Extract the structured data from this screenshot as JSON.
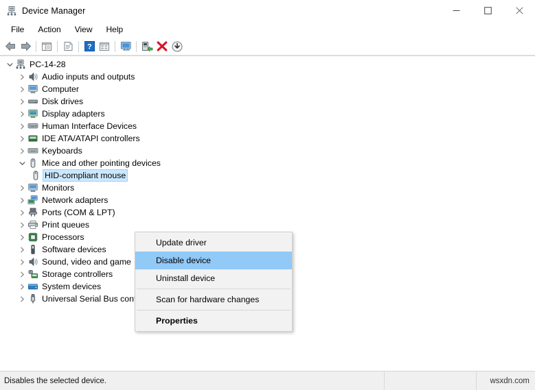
{
  "window": {
    "title": "Device Manager",
    "icon": "device-manager-icon",
    "controls": {
      "minimize": "─",
      "maximize": "□",
      "close": "✕"
    }
  },
  "menubar": {
    "items": [
      {
        "label": "File",
        "name": "menu-file"
      },
      {
        "label": "Action",
        "name": "menu-action"
      },
      {
        "label": "View",
        "name": "menu-view"
      },
      {
        "label": "Help",
        "name": "menu-help"
      }
    ]
  },
  "toolbar": {
    "buttons": [
      {
        "name": "back-icon",
        "tip": "Back"
      },
      {
        "name": "forward-icon",
        "tip": "Forward"
      },
      {
        "name": "show-hide-console-tree-icon",
        "tip": "Show/Hide Console Tree"
      },
      {
        "name": "properties-icon",
        "tip": "Properties"
      },
      {
        "name": "help-icon",
        "tip": "Help"
      },
      {
        "name": "view-list-icon",
        "tip": "View"
      },
      {
        "name": "update-driver-icon",
        "tip": "Update driver"
      },
      {
        "name": "enable-device-icon",
        "tip": "Enable device"
      },
      {
        "name": "uninstall-device-icon",
        "tip": "Uninstall device"
      },
      {
        "name": "scan-hardware-changes-icon",
        "tip": "Scan for hardware changes"
      }
    ]
  },
  "tree": {
    "root": {
      "label": "PC-14-28",
      "icon": "computer-root-icon",
      "expanded": true
    },
    "nodes": [
      {
        "label": "Audio inputs and outputs",
        "icon": "speaker-icon",
        "level": 1,
        "expanded": false,
        "selected": false
      },
      {
        "label": "Computer",
        "icon": "monitor-icon",
        "level": 1,
        "expanded": false,
        "selected": false
      },
      {
        "label": "Disk drives",
        "icon": "disk-icon",
        "level": 1,
        "expanded": false,
        "selected": false
      },
      {
        "label": "Display adapters",
        "icon": "display-adapter-icon",
        "level": 1,
        "expanded": false,
        "selected": false
      },
      {
        "label": "Human Interface Devices",
        "icon": "hid-icon",
        "level": 1,
        "expanded": false,
        "selected": false
      },
      {
        "label": "IDE ATA/ATAPI controllers",
        "icon": "ide-controller-icon",
        "level": 1,
        "expanded": false,
        "selected": false
      },
      {
        "label": "Keyboards",
        "icon": "keyboard-icon",
        "level": 1,
        "expanded": false,
        "selected": false
      },
      {
        "label": "Mice and other pointing devices",
        "icon": "mouse-icon",
        "level": 1,
        "expanded": true,
        "selected": false
      },
      {
        "label": "HID-compliant mouse",
        "icon": "mouse-icon",
        "level": 2,
        "expanded": null,
        "selected": true
      },
      {
        "label": "Monitors",
        "icon": "monitor-icon",
        "level": 1,
        "expanded": false,
        "selected": false
      },
      {
        "label": "Network adapters",
        "icon": "network-icon",
        "level": 1,
        "expanded": false,
        "selected": false
      },
      {
        "label": "Ports (COM & LPT)",
        "icon": "port-icon",
        "level": 1,
        "expanded": false,
        "selected": false
      },
      {
        "label": "Print queues",
        "icon": "printer-icon",
        "level": 1,
        "expanded": false,
        "selected": false
      },
      {
        "label": "Processors",
        "icon": "processor-icon",
        "level": 1,
        "expanded": false,
        "selected": false
      },
      {
        "label": "Software devices",
        "icon": "software-device-icon",
        "level": 1,
        "expanded": false,
        "selected": false
      },
      {
        "label": "Sound, video and game",
        "icon": "speaker-icon",
        "level": 1,
        "expanded": false,
        "selected": false
      },
      {
        "label": "Storage controllers",
        "icon": "storage-controller-icon",
        "level": 1,
        "expanded": false,
        "selected": false
      },
      {
        "label": "System devices",
        "icon": "system-device-icon",
        "level": 1,
        "expanded": false,
        "selected": false
      },
      {
        "label": "Universal Serial Bus controllers",
        "icon": "usb-icon",
        "level": 1,
        "expanded": false,
        "selected": false
      }
    ]
  },
  "context_menu": {
    "items": [
      {
        "label": "Update driver",
        "highlight": false,
        "bold": false,
        "separator_after": false
      },
      {
        "label": "Disable device",
        "highlight": true,
        "bold": false,
        "separator_after": false
      },
      {
        "label": "Uninstall device",
        "highlight": false,
        "bold": false,
        "separator_after": true
      },
      {
        "label": "Scan for hardware changes",
        "highlight": false,
        "bold": false,
        "separator_after": true
      },
      {
        "label": "Properties",
        "highlight": false,
        "bold": true,
        "separator_after": false
      }
    ]
  },
  "statusbar": {
    "message": "Disables the selected device.",
    "middle": "",
    "watermark": "wsxdn.com"
  },
  "colors": {
    "selection_blue": "#cce8ff",
    "menu_highlight": "#91c9f7",
    "menu_bg": "#f2f2f2",
    "statusbar_bg": "#f0f0f0",
    "window_bg": "#ffffff"
  }
}
